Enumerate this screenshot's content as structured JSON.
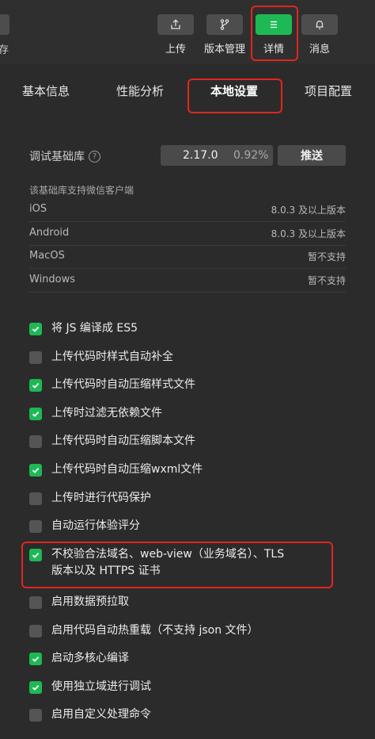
{
  "toolbar": {
    "left_stub_label": "存",
    "buttons": [
      {
        "label": "上传",
        "icon": "upload-icon"
      },
      {
        "label": "版本管理",
        "icon": "branch-icon"
      },
      {
        "label": "详情",
        "icon": "menu-icon",
        "active": true
      },
      {
        "label": "消息",
        "icon": "bell-icon"
      }
    ]
  },
  "tabs": [
    {
      "label": "基本信息"
    },
    {
      "label": "性能分析"
    },
    {
      "label": "本地设置",
      "active": true
    },
    {
      "label": "项目配置"
    }
  ],
  "debug_base": {
    "label": "调试基础库",
    "help": "?",
    "version": "2.17.0",
    "percent": "0.92%",
    "push_label": "推送"
  },
  "support": {
    "title": "该基础库支持微信客户端",
    "platforms": [
      {
        "name": "iOS",
        "value": "8.0.3 及以上版本"
      },
      {
        "name": "Android",
        "value": "8.0.3 及以上版本"
      },
      {
        "name": "MacOS",
        "value": "暂不支持"
      },
      {
        "name": "Windows",
        "value": "暂不支持"
      }
    ]
  },
  "options": [
    {
      "label": "将 JS 编译成 ES5",
      "checked": true
    },
    {
      "label": "上传代码时样式自动补全",
      "checked": false
    },
    {
      "label": "上传代码时自动压缩样式文件",
      "checked": true
    },
    {
      "label": "上传时过滤无依赖文件",
      "checked": true
    },
    {
      "label": "上传代码时自动压缩脚本文件",
      "checked": false
    },
    {
      "label": "上传代码时自动压缩wxml文件",
      "checked": true
    },
    {
      "label": "上传时进行代码保护",
      "checked": false
    },
    {
      "label": "自动运行体验评分",
      "checked": false
    },
    {
      "label": "不校验合法域名、web-view（业务域名）、TLS",
      "label2": "版本以及 HTTPS 证书",
      "checked": true
    },
    {
      "label": "启用数据预拉取",
      "checked": false
    },
    {
      "label": "启用代码自动热重载（不支持 json 文件）",
      "checked": false
    },
    {
      "label": "启动多核心编译",
      "checked": true
    },
    {
      "label": "使用独立域进行调试",
      "checked": true
    },
    {
      "label": "启用自定义处理命令",
      "checked": false
    }
  ],
  "colors": {
    "accent": "#1db954",
    "highlight": "#e2261c"
  }
}
